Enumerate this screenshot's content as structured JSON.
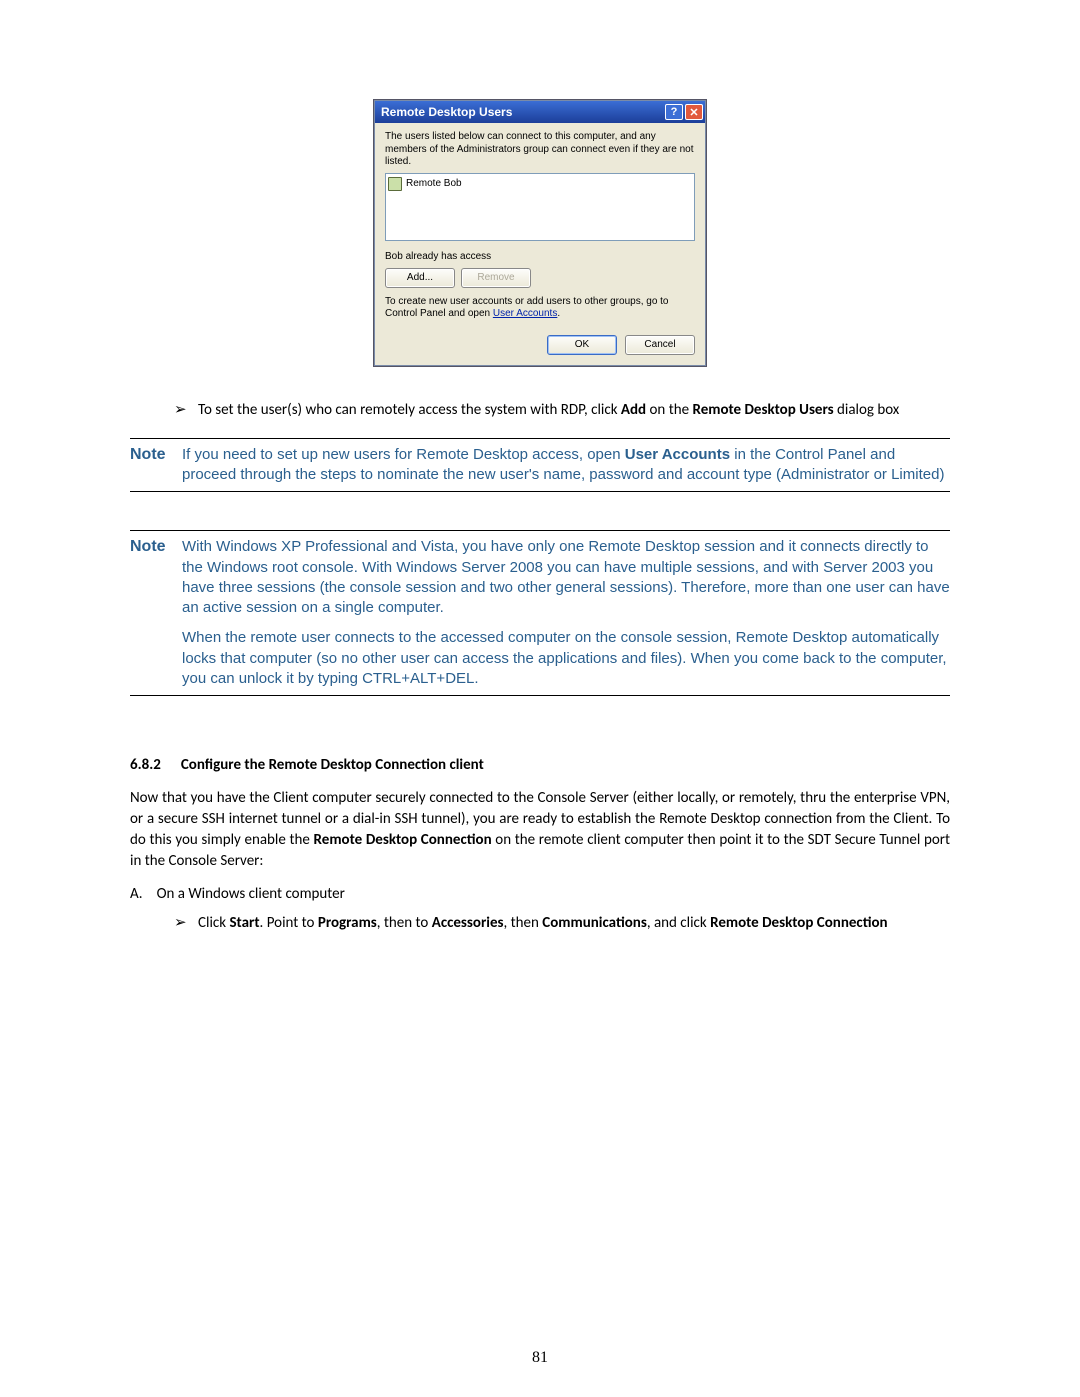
{
  "dialog": {
    "title": "Remote Desktop Users",
    "help_icon": "?",
    "close_icon": "✕",
    "description": "The users listed below can connect to this computer, and any members of the Administrators group can connect even if they are not listed.",
    "user_item": "Remote Bob",
    "status": "Bob already has access",
    "add_btn": "Add...",
    "remove_btn": "Remove",
    "hint_prefix": "To create new user accounts or add users to other groups, go to Control Panel and open ",
    "hint_link": "User Accounts",
    "hint_suffix": ".",
    "ok_btn": "OK",
    "cancel_btn": "Cancel"
  },
  "bullet1": {
    "pre": "To set the user(s) who can remotely access the system with RDP, click ",
    "b1": "Add",
    "mid": " on the ",
    "b2": "Remote Desktop Users",
    "post": " dialog box"
  },
  "note1": {
    "label": "Note",
    "pre": "If you need to set up new users for Remote Desktop access, open ",
    "b": "User Accounts",
    "post": " in the Control Panel and proceed through the steps to nominate the new user's name, password and account type (Administrator or Limited)"
  },
  "note2": {
    "label": "Note",
    "p1": "With Windows XP Professional and Vista, you have only one Remote Desktop session and it connects directly to the Windows root console. With Windows Server 2008 you can have multiple sessions, and with Server 2003 you have three sessions (the console session and two other general sessions). Therefore, more than one user can have an active session on a single computer.",
    "p2": "When the remote user connects to the accessed computer on the console session, Remote Desktop automatically locks that computer (so no other user can access the applications and files). When you come back to the computer, you can unlock it by typing CTRL+ALT+DEL."
  },
  "section": {
    "num": "6.8.2",
    "title": "Configure the Remote Desktop Connection client"
  },
  "para": {
    "pre": "Now that you have the Client computer securely connected to the Console Server (either locally, or remotely, thru the enterprise VPN, or a secure SSH internet tunnel or a dial-in SSH tunnel), you are ready to establish the Remote Desktop connection from the Client. To do this you simply enable the ",
    "b": "Remote Desktop Connection",
    "post": " on the remote client computer then point it to the SDT Secure Tunnel port in the Console Server:"
  },
  "listA": {
    "marker": "A.",
    "text": "On a Windows client computer"
  },
  "bullet2": {
    "t1": "Click ",
    "b1": "Start",
    "t2": ". Point to ",
    "b2": "Programs",
    "t3": ", then to ",
    "b3": "Accessories",
    "t4": ", then ",
    "b4": "Communications",
    "t5": ", and click ",
    "b5": "Remote Desktop Connection"
  },
  "page_number": "81"
}
